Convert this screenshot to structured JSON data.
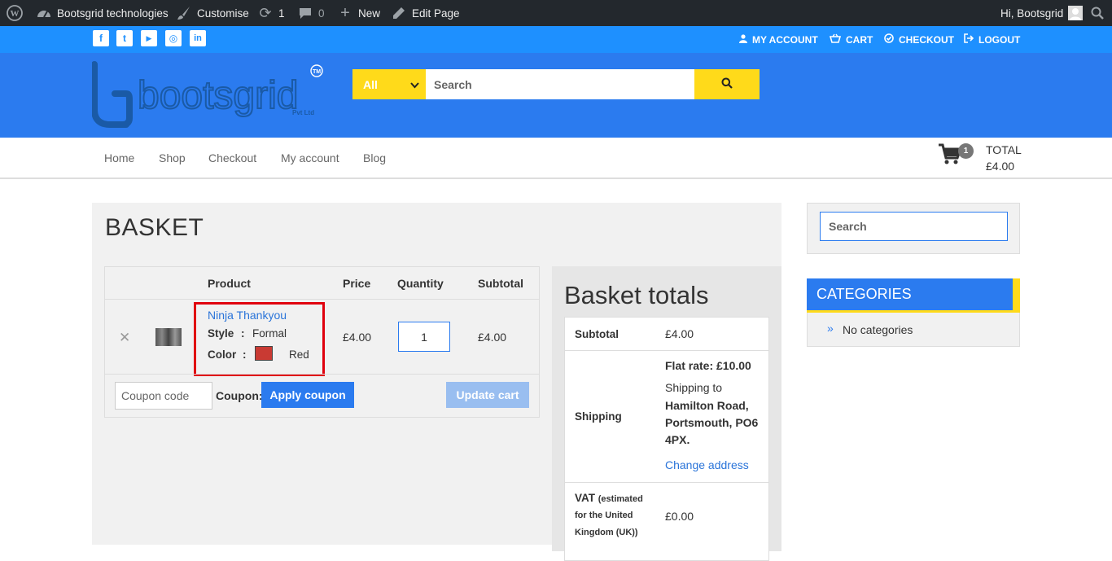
{
  "adminbar": {
    "site_name": "Bootsgrid technologies",
    "customise": "Customise",
    "updates_count": "1",
    "comments_count": "0",
    "new_label": "New",
    "edit_page": "Edit Page",
    "greeting": "Hi, Bootsgrid"
  },
  "topstrip": {
    "social": [
      {
        "icon": "facebook-icon",
        "glyph": "f"
      },
      {
        "icon": "twitter-icon",
        "glyph": "t"
      },
      {
        "icon": "youtube-icon",
        "glyph": "▶"
      },
      {
        "icon": "instagram-icon",
        "glyph": "◎"
      },
      {
        "icon": "linkedin-icon",
        "glyph": "in"
      }
    ],
    "my_account": "MY ACCOUNT",
    "cart": "CART",
    "checkout": "CHECKOUT",
    "logout": "LOGOUT"
  },
  "header": {
    "logo_text": "bootsgrid",
    "logo_sub": "Pvt Ltd",
    "logo_tm": "TM",
    "category_selected": "All",
    "search_placeholder": "Search"
  },
  "nav": {
    "items": [
      "Home",
      "Shop",
      "Checkout",
      "My account",
      "Blog"
    ],
    "cart_count": "1",
    "total_label": "TOTAL",
    "total_value": "£4.00"
  },
  "basket": {
    "title": "BASKET",
    "headers": {
      "product": "Product",
      "price": "Price",
      "quantity": "Quantity",
      "subtotal": "Subtotal"
    },
    "item": {
      "name": "Ninja Thankyou",
      "style_key": "Style",
      "style_val": "Formal",
      "color_key": "Color",
      "color_val": "Red",
      "swatch_color": "#c93a33",
      "price": "£4.00",
      "quantity": "1",
      "subtotal": "£4.00"
    },
    "coupon_placeholder": "Coupon code",
    "coupon_label": "Coupon:",
    "apply_coupon": "Apply coupon",
    "update_cart": "Update cart"
  },
  "totals": {
    "title": "Basket totals",
    "subtotal_key": "Subtotal",
    "subtotal_val": "£4.00",
    "shipping_key": "Shipping",
    "shipping_rate": "Flat rate: £10.00",
    "shipping_to": "Shipping to",
    "address_l1": "Hamilton Road,",
    "address_l2": "Portsmouth, PO6",
    "address_l3": "4PX.",
    "change_address": "Change address",
    "vat_key": "VAT",
    "vat_note_l1": "(estimated",
    "vat_note_l2": "for the United",
    "vat_note_l3": "Kingdom (UK))",
    "vat_val": "£0.00"
  },
  "sidebar": {
    "search_placeholder": "Search",
    "categories_title": "CATEGORIES",
    "no_categories": "No categories"
  },
  "colors": {
    "admin_bar": "#23282d",
    "top_strip": "#1e90ff",
    "header": "#2b7bef",
    "accent_yellow": "#ffda1a",
    "highlight_red": "#e0000d"
  }
}
